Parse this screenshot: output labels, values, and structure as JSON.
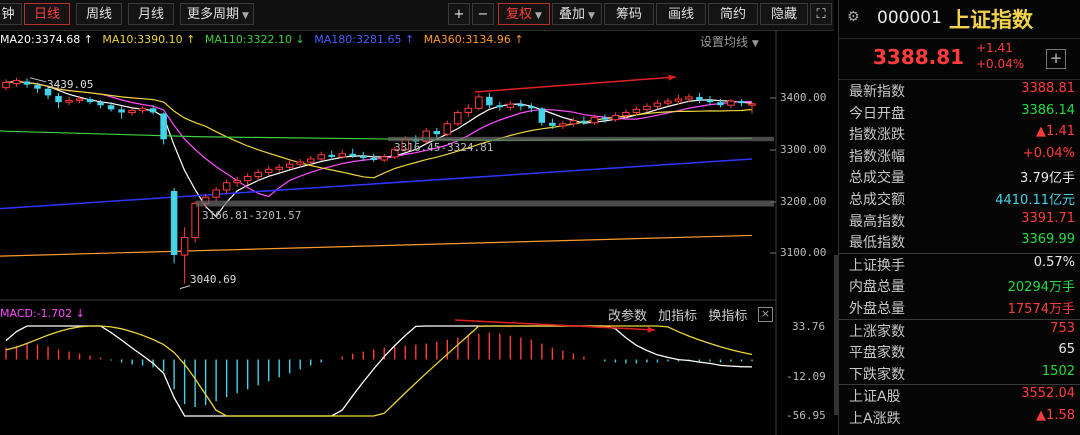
{
  "toolbar": {
    "tabs": [
      {
        "label": "钟"
      },
      {
        "label": "日线"
      },
      {
        "label": "周线"
      },
      {
        "label": "月线"
      },
      {
        "label": "更多周期"
      }
    ],
    "plus": "+",
    "minus": "−",
    "buttons": [
      {
        "label": "复权"
      },
      {
        "label": "叠加"
      },
      {
        "label": "筹码"
      },
      {
        "label": "画线"
      },
      {
        "label": "简约"
      },
      {
        "label": "隐藏"
      }
    ]
  },
  "ma": {
    "ma20": "MA20:3374.68 ↑",
    "ma10": "MA10:3390.10 ↑",
    "ma110": "MA110:3322.10 ↓",
    "ma180": "MA180:3281.65 ↑",
    "ma360": "MA360:3134.96 ↑",
    "settings": "设置均线"
  },
  "annotations": {
    "high_left": "3439.05",
    "range1": "3316.45-3324.81",
    "range2": "3166.81-3201.57",
    "low": "3040.69"
  },
  "axis": {
    "p3400": "3400.00",
    "p3300": "3300.00",
    "p3200": "3200.00",
    "p3100": "3100.00",
    "m_top": "33.76",
    "m_mid": "-12.09",
    "m_bot": "-56.95"
  },
  "macd": {
    "title": "MACD:-1.702 ↓",
    "btn_params": "改参数",
    "btn_add": "加指标",
    "btn_switch": "换指标",
    "close": "×"
  },
  "panel": {
    "code": "000001",
    "name": "上证指数",
    "price": "3388.81",
    "change": "+1.41",
    "change_pct": "+0.04%",
    "rows": [
      {
        "label": "最新指数",
        "value": "3388.81",
        "color": "red"
      },
      {
        "label": "今日开盘",
        "value": "3386.14",
        "color": "green"
      },
      {
        "label": "指数涨跌",
        "value": "▲1.41",
        "color": "red"
      },
      {
        "label": "指数涨幅",
        "value": "+0.04%",
        "color": "red"
      },
      {
        "label": "总成交量",
        "value": "3.79亿手",
        "color": "white"
      },
      {
        "label": "总成交额",
        "value": "4410.11亿元",
        "color": "cyan"
      },
      {
        "label": "最高指数",
        "value": "3391.71",
        "color": "red"
      },
      {
        "label": "最低指数",
        "value": "3369.99",
        "color": "green"
      },
      {
        "label": "上证换手",
        "value": "0.57%",
        "color": "white"
      },
      {
        "label": "内盘总量",
        "value": "20294万手",
        "color": "green"
      },
      {
        "label": "外盘总量",
        "value": "17574万手",
        "color": "red"
      },
      {
        "label": "上涨家数",
        "value": "753",
        "color": "red"
      },
      {
        "label": "平盘家数",
        "value": "65",
        "color": "white"
      },
      {
        "label": "下跌家数",
        "value": "1502",
        "color": "green"
      },
      {
        "label": "上证A股",
        "value": "3552.04",
        "color": "red"
      },
      {
        "label": "上A涨跌",
        "value": "▲1.58",
        "color": "red"
      }
    ]
  },
  "chart_data": {
    "type": "candlestick",
    "y_range": [
      3040,
      3460
    ],
    "macd_range": [
      -56.95,
      33.76
    ],
    "candles": [
      {
        "o": 3420,
        "c": 3430,
        "h": 3436,
        "l": 3415
      },
      {
        "o": 3428,
        "c": 3434,
        "h": 3439.05,
        "l": 3422
      },
      {
        "o": 3432,
        "c": 3426,
        "h": 3438,
        "l": 3420
      },
      {
        "o": 3425,
        "c": 3418,
        "h": 3430,
        "l": 3410
      },
      {
        "o": 3418,
        "c": 3405,
        "h": 3422,
        "l": 3398
      },
      {
        "o": 3404,
        "c": 3392,
        "h": 3410,
        "l": 3380
      },
      {
        "o": 3392,
        "c": 3395,
        "h": 3402,
        "l": 3386
      },
      {
        "o": 3395,
        "c": 3398,
        "h": 3404,
        "l": 3390
      },
      {
        "o": 3398,
        "c": 3392,
        "h": 3402,
        "l": 3388
      },
      {
        "o": 3392,
        "c": 3386,
        "h": 3396,
        "l": 3380
      },
      {
        "o": 3386,
        "c": 3378,
        "h": 3392,
        "l": 3374
      },
      {
        "o": 3378,
        "c": 3372,
        "h": 3384,
        "l": 3360
      },
      {
        "o": 3372,
        "c": 3376,
        "h": 3380,
        "l": 3366
      },
      {
        "o": 3376,
        "c": 3380,
        "h": 3384,
        "l": 3370
      },
      {
        "o": 3380,
        "c": 3372,
        "h": 3386,
        "l": 3368
      },
      {
        "o": 3370,
        "c": 3320,
        "h": 3372,
        "l": 3310
      },
      {
        "o": 3220,
        "c": 3096,
        "h": 3226,
        "l": 3080
      },
      {
        "o": 3096,
        "c": 3130,
        "h": 3150,
        "l": 3040.69
      },
      {
        "o": 3130,
        "c": 3196,
        "h": 3200,
        "l": 3120
      },
      {
        "o": 3196,
        "c": 3208,
        "h": 3214,
        "l": 3186
      },
      {
        "o": 3208,
        "c": 3222,
        "h": 3228,
        "l": 3200
      },
      {
        "o": 3222,
        "c": 3236,
        "h": 3242,
        "l": 3214
      },
      {
        "o": 3236,
        "c": 3240,
        "h": 3248,
        "l": 3228
      },
      {
        "o": 3240,
        "c": 3248,
        "h": 3254,
        "l": 3232
      },
      {
        "o": 3248,
        "c": 3256,
        "h": 3262,
        "l": 3240
      },
      {
        "o": 3256,
        "c": 3262,
        "h": 3268,
        "l": 3250
      },
      {
        "o": 3262,
        "c": 3266,
        "h": 3272,
        "l": 3256
      },
      {
        "o": 3266,
        "c": 3272,
        "h": 3280,
        "l": 3262
      },
      {
        "o": 3272,
        "c": 3276,
        "h": 3282,
        "l": 3266
      },
      {
        "o": 3276,
        "c": 3282,
        "h": 3288,
        "l": 3270
      },
      {
        "o": 3282,
        "c": 3290,
        "h": 3296,
        "l": 3278
      },
      {
        "o": 3290,
        "c": 3286,
        "h": 3298,
        "l": 3280
      },
      {
        "o": 3286,
        "c": 3292,
        "h": 3300,
        "l": 3282
      },
      {
        "o": 3292,
        "c": 3288,
        "h": 3302,
        "l": 3284
      },
      {
        "o": 3288,
        "c": 3284,
        "h": 3296,
        "l": 3278
      },
      {
        "o": 3284,
        "c": 3280,
        "h": 3292,
        "l": 3276
      },
      {
        "o": 3280,
        "c": 3286,
        "h": 3292,
        "l": 3276
      },
      {
        "o": 3286,
        "c": 3300,
        "h": 3306,
        "l": 3282
      },
      {
        "o": 3300,
        "c": 3320,
        "h": 3326,
        "l": 3296
      },
      {
        "o": 3320,
        "c": 3316,
        "h": 3328,
        "l": 3310
      },
      {
        "o": 3316,
        "c": 3336,
        "h": 3342,
        "l": 3312
      },
      {
        "o": 3336,
        "c": 3330,
        "h": 3342,
        "l": 3322
      },
      {
        "o": 3330,
        "c": 3350,
        "h": 3356,
        "l": 3326
      },
      {
        "o": 3350,
        "c": 3372,
        "h": 3376,
        "l": 3346
      },
      {
        "o": 3372,
        "c": 3380,
        "h": 3388,
        "l": 3364
      },
      {
        "o": 3380,
        "c": 3402,
        "h": 3408,
        "l": 3376
      },
      {
        "o": 3402,
        "c": 3386,
        "h": 3410,
        "l": 3380
      },
      {
        "o": 3386,
        "c": 3382,
        "h": 3392,
        "l": 3376
      },
      {
        "o": 3382,
        "c": 3388,
        "h": 3394,
        "l": 3376
      },
      {
        "o": 3388,
        "c": 3384,
        "h": 3396,
        "l": 3376
      },
      {
        "o": 3384,
        "c": 3380,
        "h": 3390,
        "l": 3372
      },
      {
        "o": 3380,
        "c": 3352,
        "h": 3382,
        "l": 3346
      },
      {
        "o": 3352,
        "c": 3346,
        "h": 3360,
        "l": 3340
      },
      {
        "o": 3346,
        "c": 3350,
        "h": 3356,
        "l": 3340
      },
      {
        "o": 3350,
        "c": 3356,
        "h": 3362,
        "l": 3344
      },
      {
        "o": 3356,
        "c": 3352,
        "h": 3364,
        "l": 3348
      },
      {
        "o": 3352,
        "c": 3362,
        "h": 3368,
        "l": 3348
      },
      {
        "o": 3362,
        "c": 3358,
        "h": 3368,
        "l": 3352
      },
      {
        "o": 3358,
        "c": 3366,
        "h": 3372,
        "l": 3354
      },
      {
        "o": 3366,
        "c": 3372,
        "h": 3378,
        "l": 3360
      },
      {
        "o": 3372,
        "c": 3378,
        "h": 3384,
        "l": 3366
      },
      {
        "o": 3378,
        "c": 3384,
        "h": 3390,
        "l": 3372
      },
      {
        "o": 3384,
        "c": 3390,
        "h": 3396,
        "l": 3378
      },
      {
        "o": 3390,
        "c": 3394,
        "h": 3400,
        "l": 3384
      },
      {
        "o": 3394,
        "c": 3398,
        "h": 3406,
        "l": 3388
      },
      {
        "o": 3398,
        "c": 3402,
        "h": 3408,
        "l": 3392
      },
      {
        "o": 3402,
        "c": 3396,
        "h": 3410,
        "l": 3390
      },
      {
        "o": 3396,
        "c": 3392,
        "h": 3404,
        "l": 3386
      },
      {
        "o": 3392,
        "c": 3386,
        "h": 3398,
        "l": 3382
      },
      {
        "o": 3386,
        "c": 3394,
        "h": 3398,
        "l": 3380
      },
      {
        "o": 3394,
        "c": 3390,
        "h": 3398,
        "l": 3384
      },
      {
        "o": 3386.14,
        "c": 3388.81,
        "h": 3391.71,
        "l": 3369.99
      }
    ],
    "macd_hist": [
      12,
      14,
      16,
      15,
      13,
      10,
      8,
      6,
      4,
      2,
      -1,
      -3,
      -5,
      -6,
      -8,
      -12,
      -30,
      -45,
      -48,
      -46,
      -42,
      -38,
      -34,
      -30,
      -26,
      -22,
      -18,
      -14,
      -10,
      -6,
      -3,
      0,
      3,
      6,
      8,
      10,
      12,
      13,
      14,
      15,
      16,
      18,
      20,
      22,
      24,
      26,
      27,
      26,
      24,
      22,
      20,
      16,
      12,
      9,
      6,
      3,
      0,
      -2,
      -3,
      -4,
      -4,
      -3,
      -3,
      -2,
      -2,
      -1,
      -2,
      -2,
      -3,
      -2,
      -2,
      -1.702
    ]
  }
}
